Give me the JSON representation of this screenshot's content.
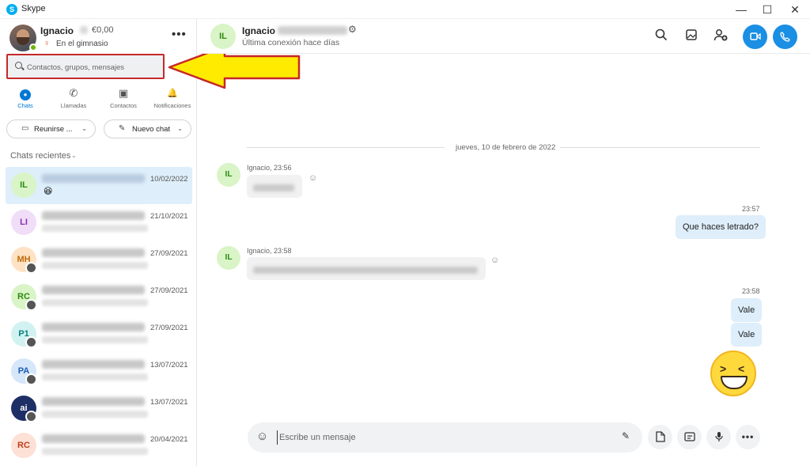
{
  "window": {
    "title": "Skype",
    "app_icon": "S",
    "min_glyph": "—",
    "max_glyph": "☐",
    "close_glyph": "✕"
  },
  "profile": {
    "name": "Ignacio",
    "credit": "€0,00",
    "mood": "En el gimnasio",
    "more": "•••"
  },
  "search": {
    "placeholder": "Contactos, grupos, mensajes"
  },
  "nav": [
    {
      "label": "Chats",
      "icon": "chat-bubble-icon",
      "glyph": "●"
    },
    {
      "label": "Llamadas",
      "icon": "phone-icon",
      "glyph": "✆"
    },
    {
      "label": "Contactos",
      "icon": "contacts-icon",
      "glyph": "▣"
    },
    {
      "label": "Notificaciones",
      "icon": "bell-icon",
      "glyph": "🔔"
    }
  ],
  "actions": {
    "meet_label": "Reunirse ...",
    "meet_icon_glyph": "▭",
    "new_chat_label": "Nuevo chat",
    "new_chat_icon_glyph": "✎",
    "chevron_glyph": "⌄"
  },
  "recent": {
    "label": "Chats recientes",
    "chevron_glyph": "⌄"
  },
  "chats": [
    {
      "initials": "IL",
      "date": "10/02/2022",
      "avatar_bg": "#d9f4c7",
      "avatar_fg": "#2c8a10",
      "active": true,
      "has_emoji": true,
      "emoji": "😆",
      "has_sub": false
    },
    {
      "initials": "LI",
      "date": "21/10/2021",
      "avatar_bg": "#f0ddf7",
      "avatar_fg": "#8a2fb0",
      "active": false,
      "has_emoji": false,
      "has_sub": false
    },
    {
      "initials": "MH",
      "date": "27/09/2021",
      "avatar_bg": "#fde3c4",
      "avatar_fg": "#c06a0a",
      "active": false,
      "has_emoji": false,
      "has_sub": true
    },
    {
      "initials": "RC",
      "date": "27/09/2021",
      "avatar_bg": "#d9f4c7",
      "avatar_fg": "#2c8a10",
      "active": false,
      "has_emoji": false,
      "has_sub": true
    },
    {
      "initials": "P1",
      "date": "27/09/2021",
      "avatar_bg": "#d2f2f2",
      "avatar_fg": "#0c7f7f",
      "active": false,
      "has_emoji": false,
      "has_sub": true
    },
    {
      "initials": "PA",
      "date": "13/07/2021",
      "avatar_bg": "#d6e6fb",
      "avatar_fg": "#1a5fb4",
      "active": false,
      "has_emoji": false,
      "has_sub": true
    },
    {
      "initials": "ai",
      "date": "13/07/2021",
      "avatar_bg": "#1e2f66",
      "avatar_fg": "#ffffff",
      "active": false,
      "has_emoji": false,
      "has_sub": true
    },
    {
      "initials": "RC",
      "date": "20/04/2021",
      "avatar_bg": "#fde0d6",
      "avatar_fg": "#c0401a",
      "active": false,
      "has_emoji": false,
      "has_sub": false
    }
  ],
  "conversation": {
    "contact_initials": "IL",
    "contact_name": "Ignacio",
    "status": "Última conexión hace días",
    "date_separator": "jueves, 10 de febrero de 2022",
    "messages": [
      {
        "direction": "in",
        "meta": "Ignacio, 23:56"
      },
      {
        "direction": "out",
        "time": "23:57",
        "text": "Que haces letrado?"
      },
      {
        "direction": "in",
        "meta": "Ignacio, 23:58"
      },
      {
        "direction": "out",
        "time": "23:58",
        "text": "Vale"
      },
      {
        "direction": "out",
        "time": "",
        "text": "Vale"
      }
    ],
    "big_emoji": "laughing-face"
  },
  "composer": {
    "placeholder": "Escribe un mensaje"
  },
  "colors": {
    "accent": "#1a8fe3",
    "highlight_border": "#c62828",
    "arrow_fill": "#ffeb00",
    "active_chat": "#deeefa"
  }
}
